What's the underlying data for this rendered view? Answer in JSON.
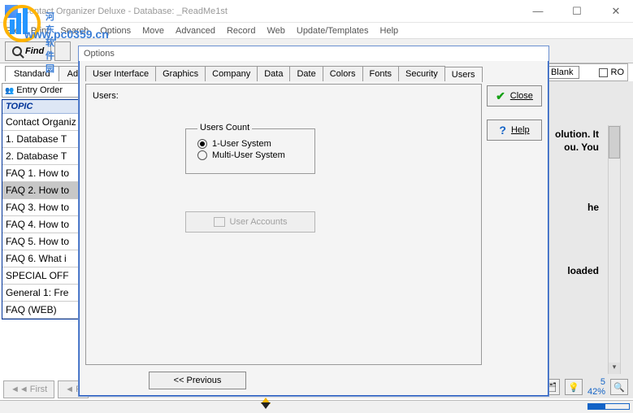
{
  "window": {
    "title": "Contact Organizer Deluxe - Database: _ReadMe1st"
  },
  "watermark": {
    "text": "河东软件园",
    "url": "www.pc0359.cn"
  },
  "menu": [
    "File",
    "Print",
    "Search",
    "Options",
    "Move",
    "Advanced",
    "Record",
    "Web",
    "Update/Templates",
    "Help"
  ],
  "toolbar": {
    "find": "Find"
  },
  "tabs2": {
    "standard": "Standard",
    "advanced": "Advanced"
  },
  "entry_order": "Entry Order",
  "topic_header": "TOPIC",
  "topics": [
    "Contact Organiz",
    "1. Database T",
    "2. Database T",
    "FAQ 1. How to",
    "FAQ 2. How to",
    "FAQ 3. How to",
    "FAQ 4. How to",
    "FAQ 5. How to",
    "FAQ 6. What i",
    "SPECIAL OFF",
    "General 1: Fre",
    "FAQ (WEB)"
  ],
  "topic_selected_index": 4,
  "right_snips": {
    "a": "olution. It",
    "b": "ou. You",
    "c": "he",
    "d": "loaded"
  },
  "right_top": {
    "blank": "Blank",
    "ro": "RO"
  },
  "nav": {
    "first": "First",
    "prev": "P"
  },
  "dialog": {
    "title": "Options",
    "tabs": [
      "User Interface",
      "Graphics",
      "Company",
      "Data",
      "Date",
      "Colors",
      "Fonts",
      "Security",
      "Users"
    ],
    "active_tab": "Users",
    "users_label": "Users:",
    "users_count_legend": "Users Count",
    "opt_single": "1-User System",
    "opt_multi": "Multi-User System",
    "selected_opt": "single",
    "user_accounts": "User Accounts",
    "close": "Close",
    "help": "Help",
    "previous": "<<  Previous"
  },
  "br": {
    "num": "5",
    "pct": "42%"
  }
}
